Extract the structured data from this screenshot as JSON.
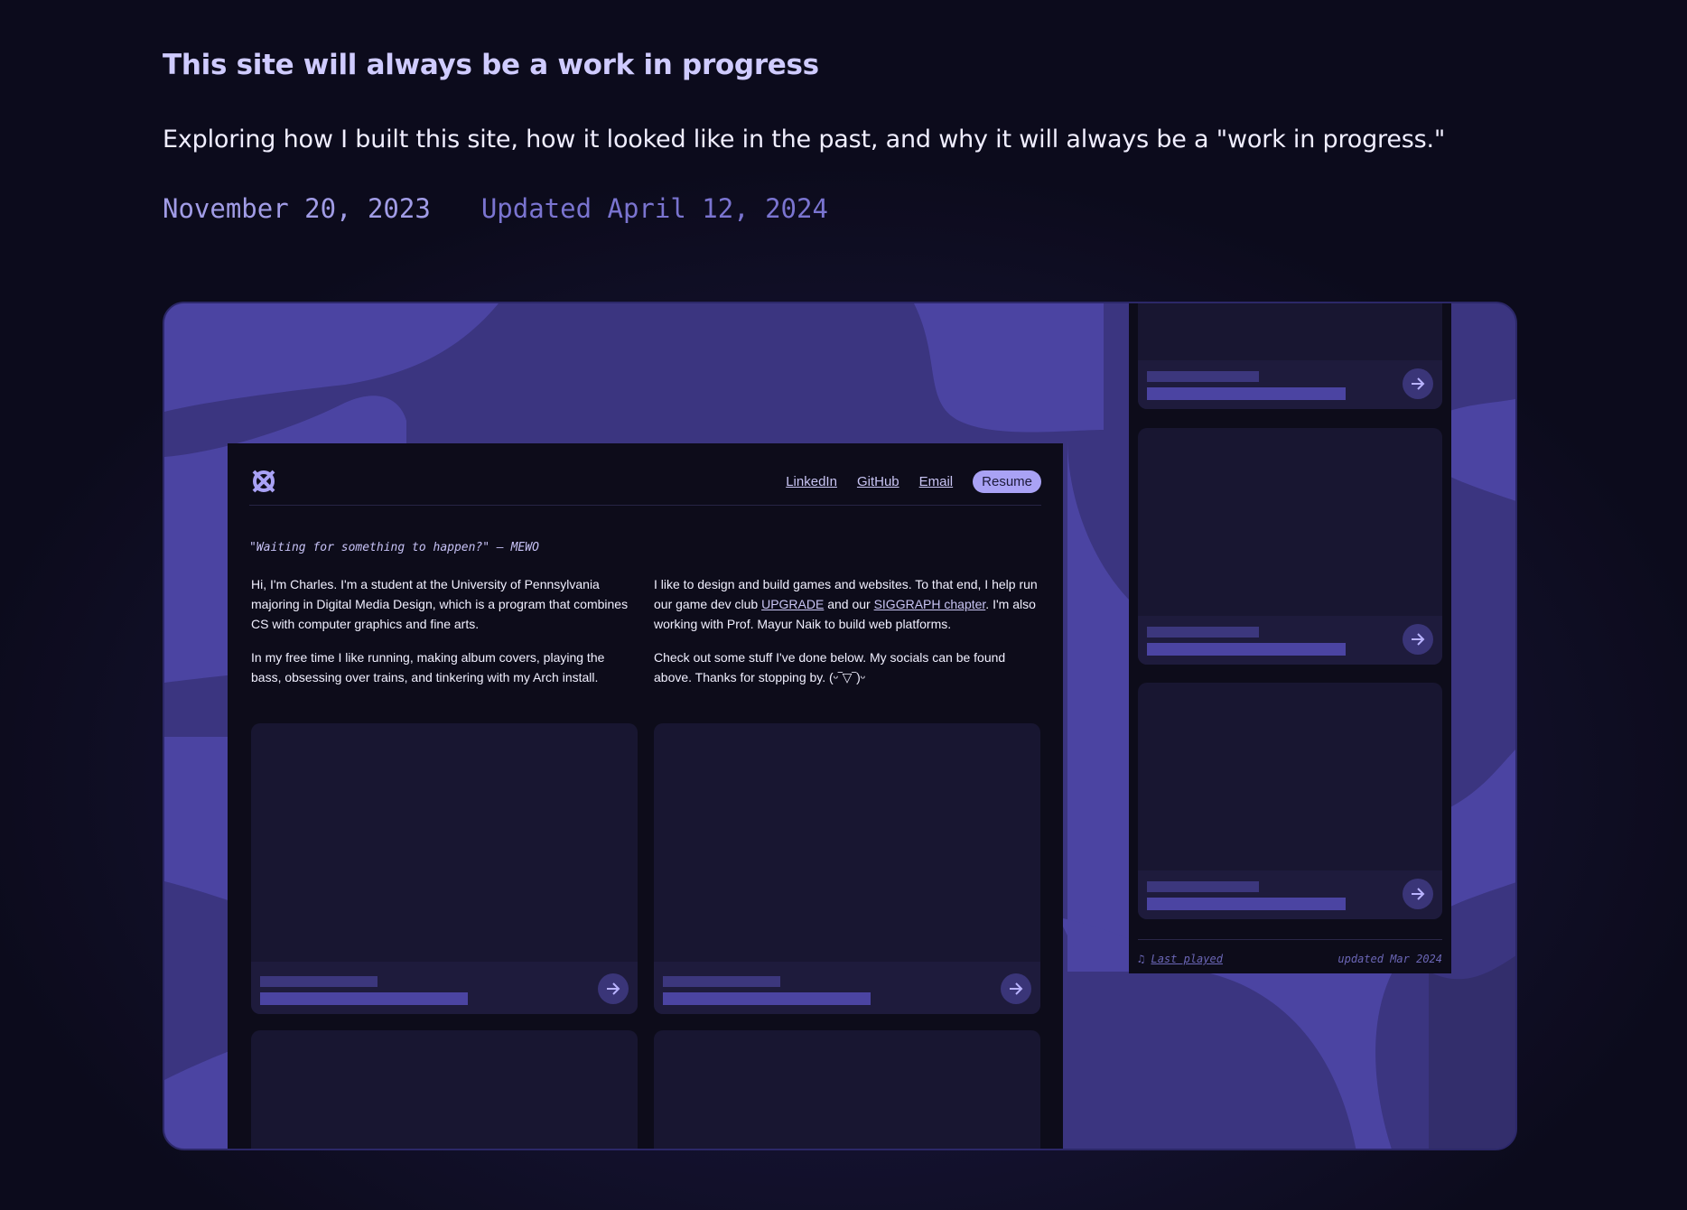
{
  "article": {
    "title": "This site will always be a work in progress",
    "subtitle": "Exploring how I built this site, how it looked like in the past, and why it will always be a \"work in progress.\"",
    "date_published": "November 20, 2023",
    "date_updated": "Updated April 12, 2024"
  },
  "screenshot": {
    "nav": {
      "linkedin": "LinkedIn",
      "github": "GitHub",
      "email": "Email",
      "resume": "Resume"
    },
    "quote": "\"Waiting for something to happen?\" — MEWO",
    "intro_left": {
      "p1": "Hi, I'm Charles. I'm a student at the University of Pennsylvania majoring in Digital Media Design, which is a program that combines CS with computer graphics and fine arts.",
      "p2": "In my free time I like running, making album covers, playing the bass, obsessing over trains, and tinkering with my Arch install."
    },
    "intro_right": {
      "p1_a": "I like to design and build games and websites. To that end, I help run our game dev club ",
      "p1_link1": "UPGRADE",
      "p1_b": " and our ",
      "p1_link2": "SIGGRAPH chapter",
      "p1_c": ". I'm also working with Prof. Mayur Naik to build web platforms.",
      "p2": "Check out some stuff I've done below. My socials can be found above. Thanks for stopping by. (ᵕ‾▽‾)ᵕ"
    },
    "mobile_footer": {
      "last_played": "Last played",
      "updated": "updated Mar 2024"
    }
  },
  "colors": {
    "background": "#0c0b1c",
    "accent": "#a9a2f5",
    "title": "#cfcbff",
    "blob": "#4b44a2"
  },
  "icons": [
    "logo-icon",
    "arrow-right-icon",
    "music-note-icon"
  ]
}
